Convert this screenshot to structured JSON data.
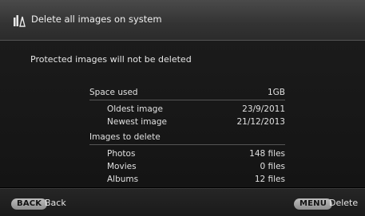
{
  "header": {
    "title": "Delete all images on system",
    "icon": "delete-images-icon"
  },
  "notice": "Protected images will not be deleted",
  "info": {
    "space_used": {
      "label": "Space used",
      "value": "1GB"
    },
    "oldest_image": {
      "label": "Oldest image",
      "value": "23/9/2011"
    },
    "newest_image": {
      "label": "Newest image",
      "value": "21/12/2013"
    },
    "images_to_delete": {
      "label": "Images to delete"
    },
    "photos": {
      "label": "Photos",
      "value": "148 files"
    },
    "movies": {
      "label": "Movies",
      "value": "0 files"
    },
    "albums": {
      "label": "Albums",
      "value": "12 files"
    }
  },
  "footer": {
    "back_key": "BACK",
    "back_label": "Back",
    "menu_key": "MENU",
    "menu_label": "Delete"
  },
  "colors": {
    "background": "#000000",
    "header": "#3a3a3a",
    "pill": "#a8a8a8",
    "text": "#e8e8e8"
  }
}
